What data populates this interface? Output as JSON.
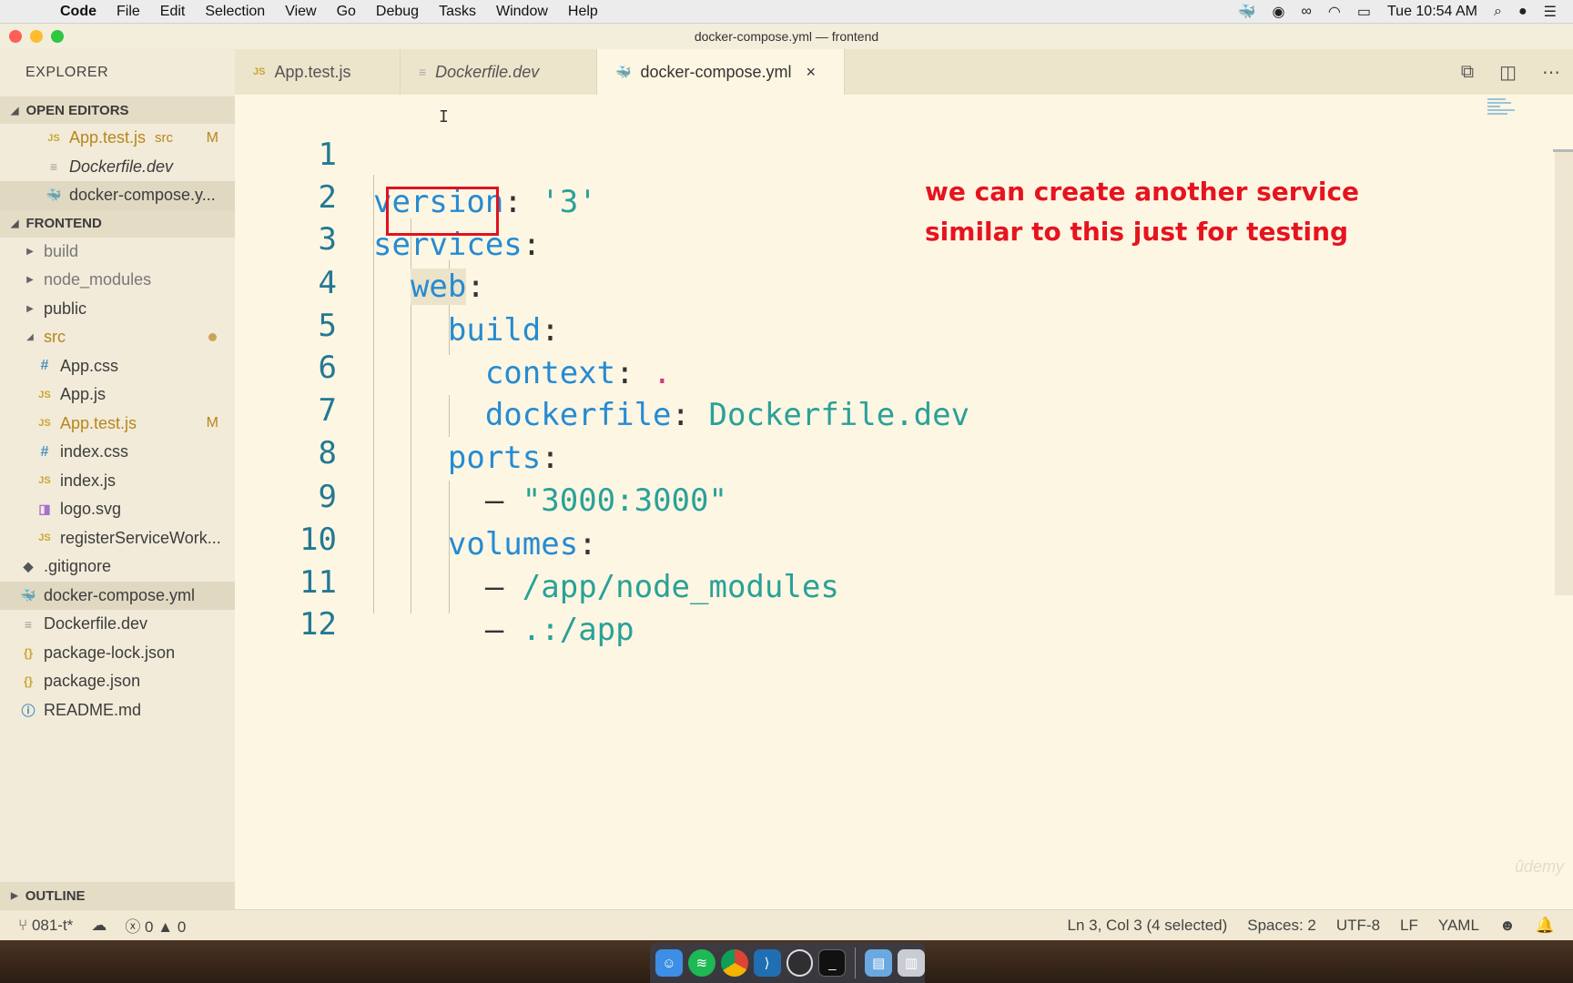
{
  "menubar": {
    "apple": "",
    "items": [
      "Code",
      "File",
      "Edit",
      "Selection",
      "View",
      "Go",
      "Debug",
      "Tasks",
      "Window",
      "Help"
    ],
    "clock": "Tue 10:54 AM"
  },
  "window": {
    "title": "docker-compose.yml — frontend"
  },
  "sidebar": {
    "explorer_label": "EXPLORER",
    "open_editors_label": "OPEN EDITORS",
    "open_editors": [
      {
        "name": "App.test.js",
        "dir": "src",
        "badge": "M"
      },
      {
        "name": "Dockerfile.dev"
      },
      {
        "name": "docker-compose.y..."
      }
    ],
    "project_label": "FRONTEND",
    "tree": {
      "build": "build",
      "node_modules": "node_modules",
      "public": "public",
      "src": "src",
      "app_css": "App.css",
      "app_js": "App.js",
      "app_test_js": "App.test.js",
      "app_test_badge": "M",
      "index_css": "index.css",
      "index_js": "index.js",
      "logo_svg": "logo.svg",
      "register_sw": "registerServiceWork...",
      "gitignore": ".gitignore",
      "docker_compose": "docker-compose.yml",
      "dockerfile_dev": "Dockerfile.dev",
      "package_lock": "package-lock.json",
      "package_json": "package.json",
      "readme": "README.md"
    },
    "outline_label": "OUTLINE"
  },
  "tabs": [
    {
      "label": "App.test.js",
      "icon": "JS"
    },
    {
      "label": "Dockerfile.dev",
      "icon": "≡"
    },
    {
      "label": "docker-compose.yml",
      "icon": "whale",
      "close": "×"
    }
  ],
  "editor": {
    "line_numbers": [
      "1",
      "2",
      "3",
      "4",
      "5",
      "6",
      "7",
      "8",
      "9",
      "10",
      "11",
      "12"
    ],
    "tokens": {
      "version_key": "version",
      "version_val": "'3'",
      "services_key": "services",
      "web_key": "web",
      "build_key": "build",
      "context_key": "context",
      "context_val": ".",
      "dockerfile_key": "dockerfile",
      "dockerfile_val": "Dockerfile.dev",
      "ports_key": "ports",
      "ports_val": "\"3000:3000\"",
      "volumes_key": "volumes",
      "vol1": "/app/node_modules",
      "vol2": ".:/app",
      "colon": ":",
      "dash": "–"
    },
    "annotation_line1": "we can create another service",
    "annotation_line2": "similar to this just for testing",
    "watermark": "ûdemy"
  },
  "statusbar": {
    "branch": "081-t*",
    "errors": "0",
    "warnings": "0",
    "position": "Ln 3, Col 3 (4 selected)",
    "spaces": "Spaces: 2",
    "encoding": "UTF-8",
    "eol": "LF",
    "language": "YAML"
  },
  "colors": {
    "editor_bg": "#fdf6e3",
    "keyword": "#268bd2",
    "string": "#2aa198",
    "annotation": "#e5141f",
    "modified": "#b8861b"
  }
}
